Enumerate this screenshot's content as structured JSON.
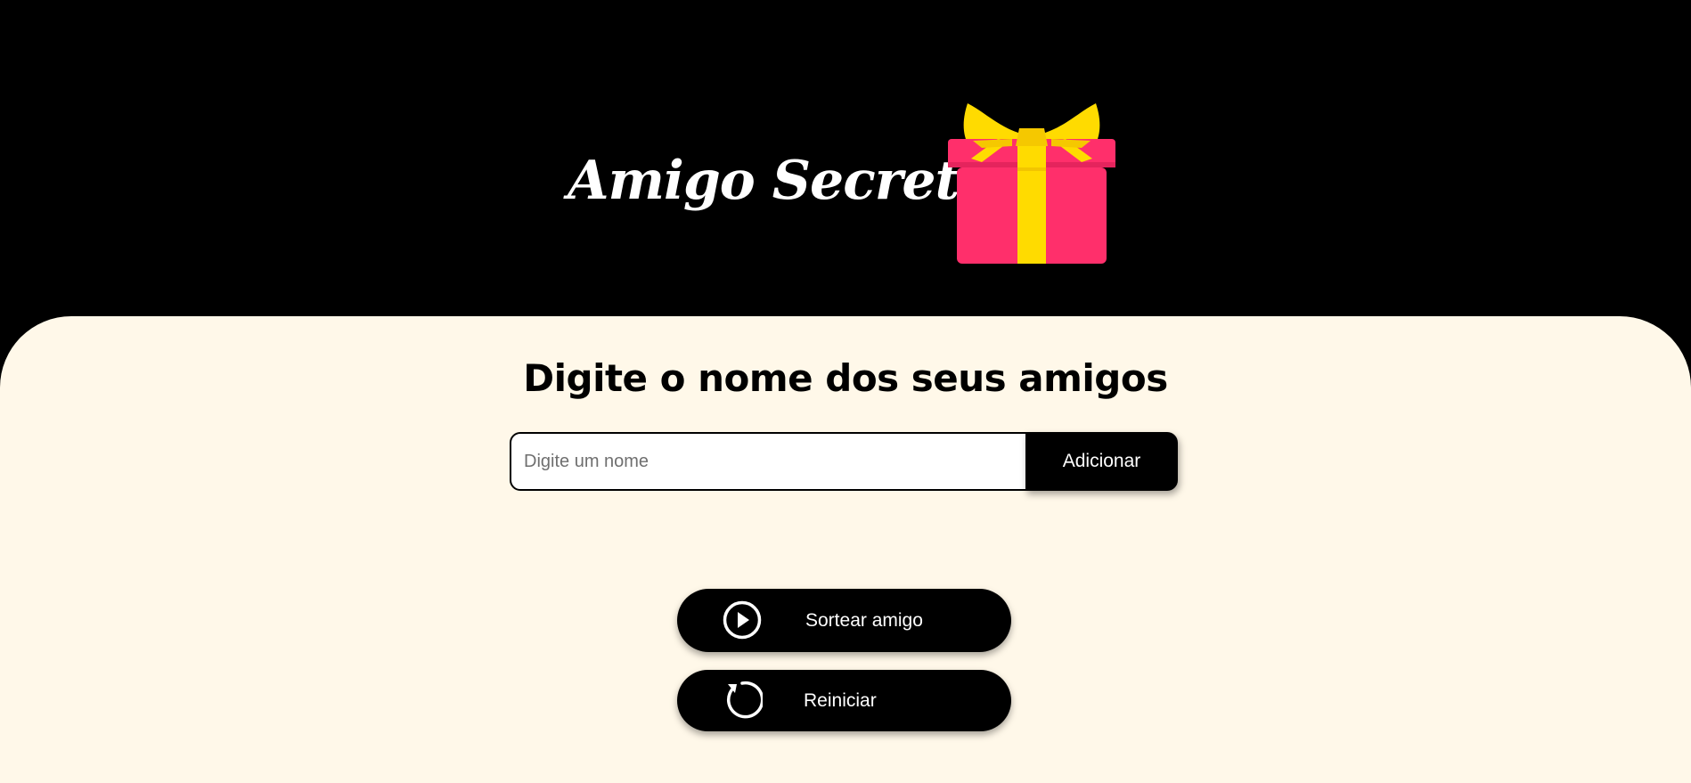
{
  "header": {
    "title": "Amigo Secreto",
    "logo_icon": "gift-icon"
  },
  "main": {
    "subtitle": "Digite o nome dos seus amigos",
    "name_input": {
      "value": "",
      "placeholder": "Digite um nome"
    },
    "add_button_label": "Adicionar",
    "draw_button": {
      "label": "Sortear amigo",
      "icon": "play-circle-icon"
    },
    "reset_button": {
      "label": "Reiniciar",
      "icon": "restart-icon"
    }
  },
  "colors": {
    "header_background": "#000000",
    "main_background": "#fff8e9",
    "button_background": "#000000",
    "button_text": "#ffffff",
    "gift_box": "#ff2f6b",
    "gift_ribbon": "#ffdb00"
  }
}
